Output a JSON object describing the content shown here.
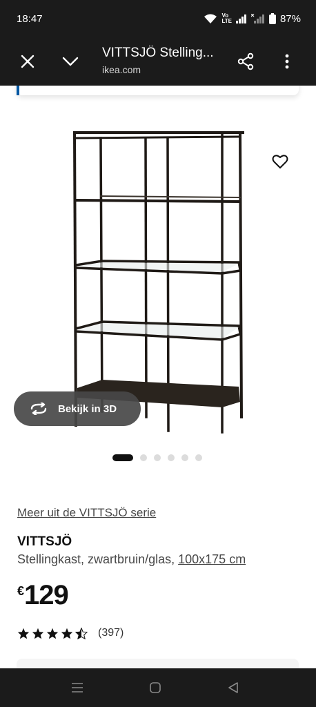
{
  "status_bar": {
    "time": "18:47",
    "volte_line1": "Vo",
    "volte_line2": "LTE",
    "battery": "87%"
  },
  "app_bar": {
    "title": "VITTSJÖ Stelling...",
    "domain": "ikea.com",
    "icons": [
      "close-icon",
      "chevron-down-icon",
      "share-icon",
      "more-vertical-icon"
    ]
  },
  "product": {
    "image_icon": "shelving-unit-image",
    "view_3d_label": "Bekijk in 3D",
    "carousel": {
      "count": 6,
      "active_index": 0
    },
    "series_link": "Meer uit de VITTSJÖ serie",
    "name": "VITTSJÖ",
    "description": "Stellingkast, zwartbruin/glas,",
    "size": "100x175 cm",
    "currency": "€",
    "price": "129",
    "rating_value": 4.5,
    "rating_max": 5,
    "review_count": "(397)"
  },
  "colors": {
    "bar_background": "#1b1b1b",
    "accent_blue": "#0058a3",
    "text_dark": "#111111",
    "text_grey": "#484848"
  }
}
